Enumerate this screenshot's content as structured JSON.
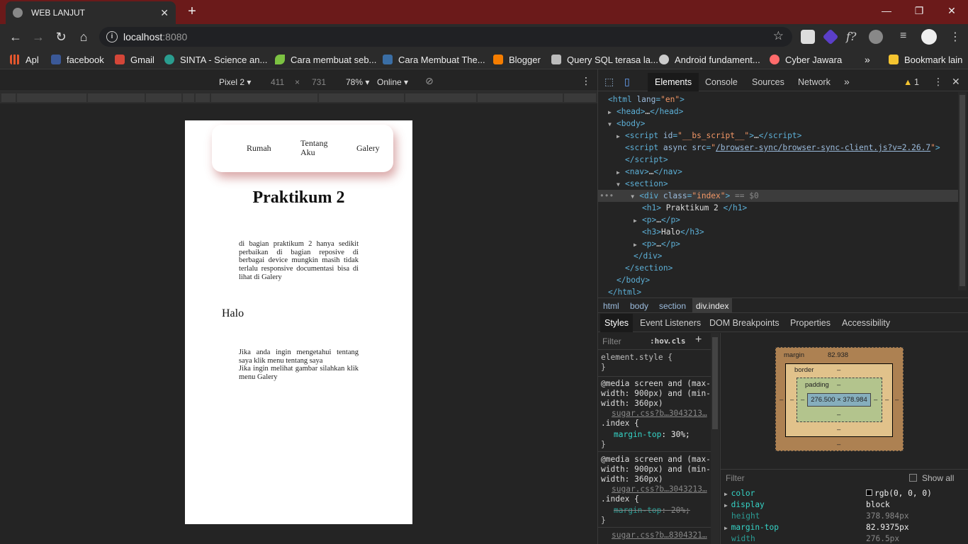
{
  "browser": {
    "tab_title": "WEB LANJUT",
    "url_host": "localhost",
    "url_port": ":8080",
    "bookmarks": [
      "Apl",
      "facebook",
      "Gmail",
      "SINTA - Science an...",
      "Cara membuat seb...",
      "Cara Membuat The...",
      "Blogger",
      "Query SQL terasa la...",
      "Android fundament...",
      "Cyber Jawara",
      "Bookmark lain"
    ],
    "bookmark_colors": [
      "#e4572e",
      "#3b5998",
      "#d44638",
      "#2a9d8f",
      "#7cc242",
      "#3a6ea5",
      "#f57d00",
      "#bbbbbb",
      "#cccccc",
      "#ff6b6b",
      "#f4c430"
    ]
  },
  "device_toolbar": {
    "device": "Pixel 2",
    "width": "411",
    "times": "×",
    "height": "731",
    "zoom": "78%",
    "throttle": "Online"
  },
  "page": {
    "nav": [
      "Rumah",
      "Tentang Aku",
      "Galery"
    ],
    "h1": "Praktikum 2",
    "p1": "di bagian praktikum 2 hanya sedikit perbaikan di bagian reposive di berbagai device mungkin masih tidak terlalu responsive documentasi bisa di lihat di Galery",
    "h3": "Halo",
    "p2a": "Jika anda ingin mengetahui tentang saya klik menu tentang saya",
    "p2b": "Jika ingin melihat gambar silahkan klik menu Galery"
  },
  "devtools": {
    "tabs": [
      "Elements",
      "Console",
      "Sources",
      "Network"
    ],
    "more": "»",
    "warnings": "1",
    "breadcrumb": [
      "html",
      "body",
      "section",
      "div.index"
    ],
    "style_tabs": [
      "Styles",
      "Event Listeners",
      "DOM Breakpoints",
      "Properties",
      "Accessibility"
    ],
    "filter_placeholder": "Filter",
    "hov": ":hov",
    "cls": ".cls",
    "element_style": "element.style {",
    "media": "@media screen and (max-width: 900px) and (min-width: 360px)",
    "src1": "sugar.css?b…3043213…",
    "src2": "sugar.css?b…3043213…",
    "src3": "sugar.css?b…8304321…",
    "selector": ".index {",
    "rule1_prop": "margin-top",
    "rule1_val": "30%;",
    "rule2_prop": "margin-top",
    "rule2_val": "20%;",
    "box_model": {
      "margin_label": "margin",
      "margin_value": "82.938",
      "border_label": "border",
      "padding_label": "padding",
      "content": "276.500 × 378.984",
      "dash": "–"
    },
    "computed_filter": "Filter",
    "show_all": "Show all",
    "computed": [
      {
        "prop": "color",
        "val": "rgb(0, 0, 0)"
      },
      {
        "prop": "display",
        "val": "block"
      },
      {
        "prop": "height",
        "val": "378.984px"
      },
      {
        "prop": "margin-top",
        "val": "82.9375px"
      },
      {
        "prop": "width",
        "val": "276.5px"
      }
    ]
  }
}
